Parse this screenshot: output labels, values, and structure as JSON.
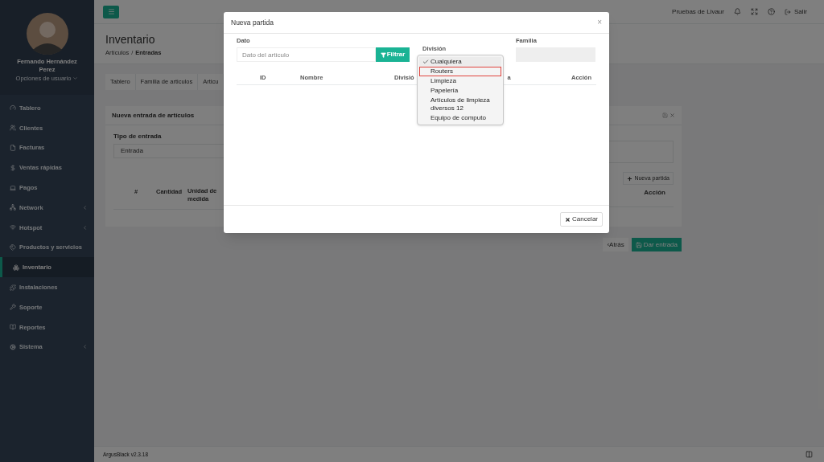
{
  "sidebar": {
    "user": {
      "name": "Fernando Hernández Perez",
      "options": "Opciones de usuario"
    },
    "items": [
      {
        "label": "Tablero",
        "selected": false,
        "expandable": false
      },
      {
        "label": "Clientes",
        "selected": false,
        "expandable": false
      },
      {
        "label": "Facturas",
        "selected": false,
        "expandable": false
      },
      {
        "label": "Ventas rápidas",
        "selected": false,
        "expandable": false
      },
      {
        "label": "Pagos",
        "selected": false,
        "expandable": false
      },
      {
        "label": "Network",
        "selected": false,
        "expandable": true
      },
      {
        "label": "Hotspot",
        "selected": false,
        "expandable": true
      },
      {
        "label": "Productos y servicios",
        "selected": false,
        "expandable": false
      },
      {
        "label": "Inventario",
        "selected": true,
        "expandable": false
      },
      {
        "label": "Instalaciones",
        "selected": false,
        "expandable": false
      },
      {
        "label": "Soporte",
        "selected": false,
        "expandable": false
      },
      {
        "label": "Reportes",
        "selected": false,
        "expandable": false
      },
      {
        "label": "Sistema",
        "selected": false,
        "expandable": true
      }
    ]
  },
  "topbar": {
    "account": "Pruebas de Livaur",
    "logout": "Salir"
  },
  "page": {
    "title": "Inventario",
    "breadcrumb": [
      "Artículos",
      "/",
      "Entradas"
    ],
    "tabs": [
      {
        "label": "Tablero",
        "selected": false
      },
      {
        "label": "Familia de articulos",
        "selected": false
      },
      {
        "label": "Articu",
        "selected": false
      }
    ],
    "panel": {
      "title": "Nueva entrada de artículos",
      "type_label": "Tipo de entrada",
      "type_value": "Entrada",
      "add_button": "Nueva partida",
      "columns_left": [
        "#",
        "Cantidad",
        "Unidad de medida"
      ],
      "column_right": "Acción"
    },
    "back_button": "‹Atrás",
    "submit_button": "Dar entrada"
  },
  "footer": {
    "version": "ArgusBlack v2.3.18"
  },
  "modal": {
    "title": "Nueva partida",
    "close": "×",
    "dato_label": "Dato",
    "dato_placeholder": "Dato del artículo",
    "filter_button": "Filtrar",
    "division_label": "División",
    "familia_label": "Familia",
    "columns": [
      "ID",
      "Nombre",
      "Divisió",
      "a",
      "Acción"
    ],
    "division_options": [
      {
        "label": "Cualquiera",
        "selected": true,
        "highlighted": false
      },
      {
        "label": "Routers",
        "selected": false,
        "highlighted": true
      },
      {
        "label": "Limpieza",
        "selected": false,
        "highlighted": false
      },
      {
        "label": "Papelería",
        "selected": false,
        "highlighted": false
      },
      {
        "label": "Artículos de limpieza diversos 12",
        "selected": false,
        "highlighted": false
      },
      {
        "label": "Equipo de computo",
        "selected": false,
        "highlighted": false
      }
    ],
    "cancel_button": "Cancelar"
  }
}
